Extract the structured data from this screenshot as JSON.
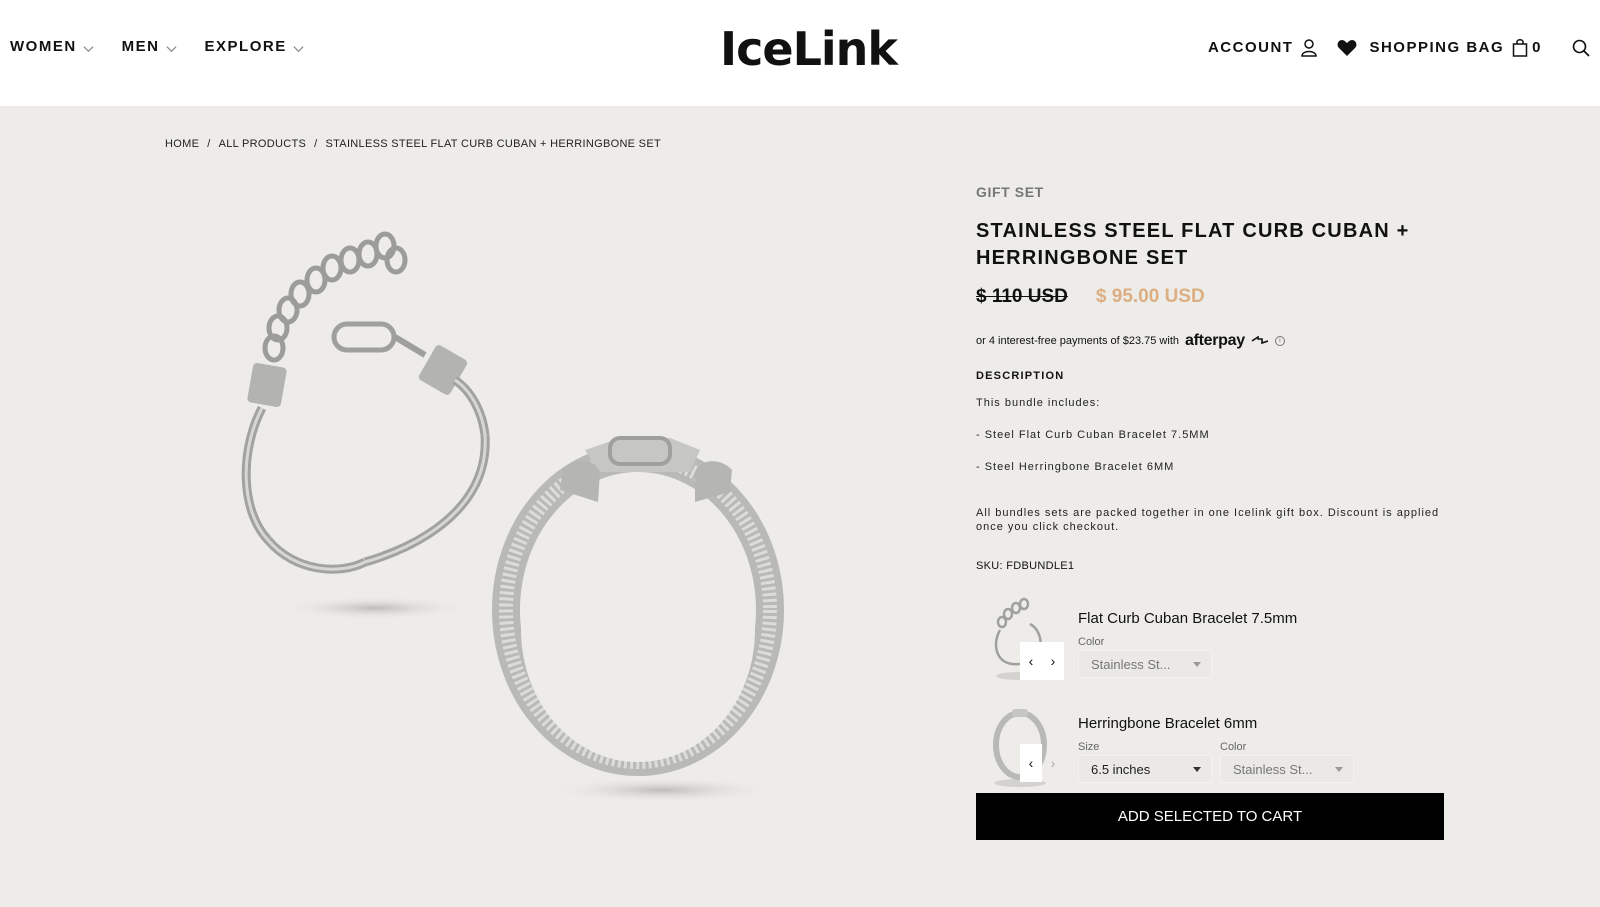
{
  "header": {
    "nav_left": [
      "WOMEN",
      "MEN",
      "EXPLORE"
    ],
    "logo": "IceLink",
    "account": "ACCOUNT",
    "shopping_bag": "SHOPPING BAG",
    "bag_count": "0"
  },
  "breadcrumb": {
    "home": "HOME",
    "all_products": "ALL PRODUCTS",
    "current": "STAINLESS STEEL FLAT CURB CUBAN + HERRINGBONE SET",
    "separator": "/"
  },
  "product": {
    "eyebrow": "GIFT SET",
    "title": "STAINLESS STEEL FLAT CURB CUBAN + HERRINGBONE SET",
    "old_price": "$ 110 USD",
    "new_price": "$ 95.00 USD",
    "afterpay_text": "or 4 interest-free payments of $23.75 with",
    "afterpay_logo": "afterpay",
    "description_heading": "DESCRIPTION",
    "description": [
      "This bundle includes:",
      "- Steel Flat Curb Cuban Bracelet 7.5MM",
      "- Steel Herringbone Bracelet 6MM",
      "All bundles sets are packed together in one Icelink gift box. Discount is applied once you click checkout."
    ],
    "sku": "SKU: FDBUNDLE1",
    "colors": {
      "accent_price": "#dcae82",
      "button_bg": "#000000",
      "page_bg": "#edece8"
    }
  },
  "bundle": [
    {
      "name": "Flat Curb Cuban Bracelet 7.5mm",
      "color_label": "Color",
      "color_value": "Stainless St..."
    },
    {
      "name": "Herringbone Bracelet 6mm",
      "size_label": "Size",
      "size_value": "6.5 inches",
      "color_label": "Color",
      "color_value": "Stainless St..."
    }
  ],
  "cta": {
    "add_to_cart": "ADD SELECTED TO CART"
  },
  "icons": [
    "chevron-down-icon",
    "user-icon",
    "heart-icon",
    "shopping-bag-icon",
    "search-icon",
    "chevron-left-icon",
    "chevron-right-icon",
    "info-icon"
  ]
}
